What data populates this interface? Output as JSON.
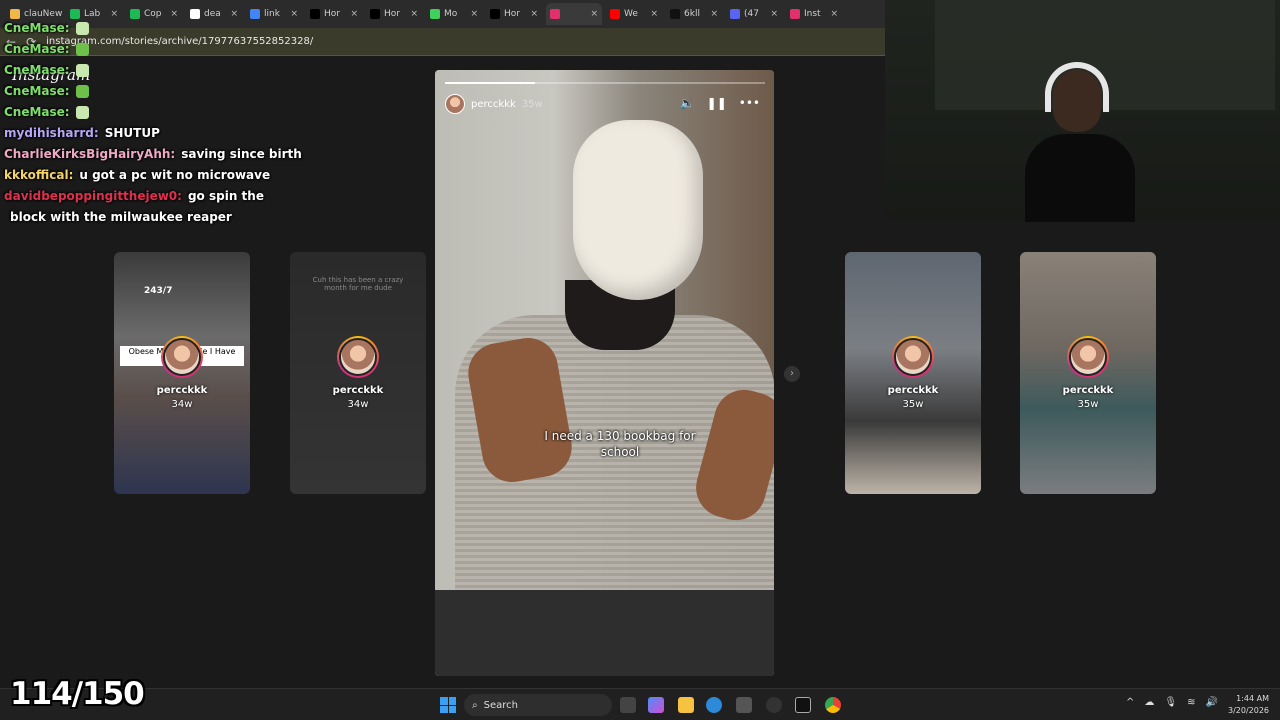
{
  "browser": {
    "tabs": [
      {
        "label": "clauNew",
        "icon": "site-icon"
      },
      {
        "label": "Lab",
        "icon": "lab-icon"
      },
      {
        "label": "Cop",
        "icon": "spotify-icon"
      },
      {
        "label": "dea",
        "icon": "google-icon"
      },
      {
        "label": "link",
        "icon": "doc-icon"
      },
      {
        "label": "Hor",
        "icon": "x-icon"
      },
      {
        "label": "Hor",
        "icon": "x-icon"
      },
      {
        "label": "Mo",
        "icon": "k-icon"
      },
      {
        "label": "Hor",
        "icon": "x-icon"
      },
      {
        "label": "",
        "icon": "instagram-icon",
        "active": true
      },
      {
        "label": "We",
        "icon": "youtube-icon"
      },
      {
        "label": "6kll",
        "icon": "tiktok-icon"
      },
      {
        "label": "(47",
        "icon": "discord-icon"
      },
      {
        "label": "Inst",
        "icon": "instagram-icon"
      }
    ],
    "url": "instagram.com/stories/archive/17977637552852328/"
  },
  "instagram": {
    "logo": "Instagram"
  },
  "chat": [
    {
      "user": "CneMase:",
      "msg": "",
      "color": "#7ee06b"
    },
    {
      "user": "CneMase:",
      "msg": "",
      "color": "#7ee06b"
    },
    {
      "user": "CneMase:",
      "msg": "",
      "color": "#7ee06b"
    },
    {
      "user": "CneMase:",
      "msg": "",
      "color": "#7ee06b"
    },
    {
      "user": "CneMase:",
      "msg": "",
      "color": "#7ee06b"
    },
    {
      "user": "mydihisharrd:",
      "msg": "SHUTUP",
      "color": "#b7a6f5"
    },
    {
      "user": "CharlieKirksBigHairyAhh:",
      "msg": "saving since birth",
      "color": "#f0a9c5"
    },
    {
      "user": "kkkoffical:",
      "msg": "u got a pc wit no microwave",
      "color": "#f3d36a"
    },
    {
      "user": "davidbepoppingitthejew0:",
      "msg": "go spin the",
      "color": "#e0304f"
    },
    {
      "user": "",
      "msg": "block with the milwaukee reaper",
      "color": "#ffffff"
    }
  ],
  "cards": [
    {
      "name": "percckkk",
      "age": "34w",
      "overlay": "Obese Man Tells Me I Have L... ps",
      "top_text": "243/7"
    },
    {
      "name": "percckkk",
      "age": "34w",
      "overlay": "Cuh this has been a crazy month for me dude",
      "top_text": ""
    },
    {
      "name": "percckkk",
      "age": "35w",
      "overlay": "",
      "top_text": ""
    },
    {
      "name": "percckkk",
      "age": "35w",
      "overlay": "",
      "top_text": ""
    }
  ],
  "story": {
    "username": "percckkk",
    "age": "35w",
    "caption": "I need a 130 bookbag for school",
    "progress": 0.28
  },
  "counter": "114/150",
  "taskbar": {
    "search_label": "Search",
    "time": "1:44 AM",
    "date": "3/20/2026"
  },
  "colors": {
    "accent": "#e1306c",
    "page_bg": "#1a1a1a"
  }
}
